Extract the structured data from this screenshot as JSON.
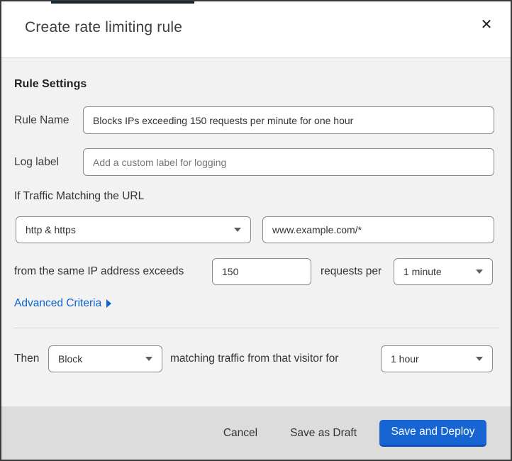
{
  "backdrop": {
    "top_bar_color": "#0c2333"
  },
  "modal": {
    "title": "Create rate limiting rule",
    "close_icon": "✕",
    "section_heading": "Rule Settings",
    "fields": {
      "rule_name": {
        "label": "Rule Name",
        "value": "Blocks IPs exceeding 150 requests per minute for one hour"
      },
      "log_label": {
        "label": "Log label",
        "placeholder": "Add a custom label for logging"
      }
    },
    "match": {
      "intro": "If Traffic Matching the URL",
      "scheme_select": {
        "value": "http & https"
      },
      "url_input": {
        "value": "www.example.com/*"
      },
      "threshold_prefix": "from the same IP address exceeds",
      "threshold_input": {
        "value": "150"
      },
      "threshold_suffix": "requests per",
      "period_select": {
        "value": "1 minute"
      },
      "advanced_link": "Advanced Criteria"
    },
    "action": {
      "prefix": "Then",
      "action_select": {
        "value": "Block"
      },
      "middle": "matching traffic from that visitor for",
      "duration_select": {
        "value": "1 hour"
      }
    },
    "footer": {
      "cancel": "Cancel",
      "save_draft": "Save as Draft",
      "save_deploy": "Save and Deploy"
    },
    "colors": {
      "primary_button": "#1765d2",
      "link_blue": "#0f63cc",
      "body_background": "#f2f2f2",
      "footer_background": "#dcdcdc"
    }
  }
}
